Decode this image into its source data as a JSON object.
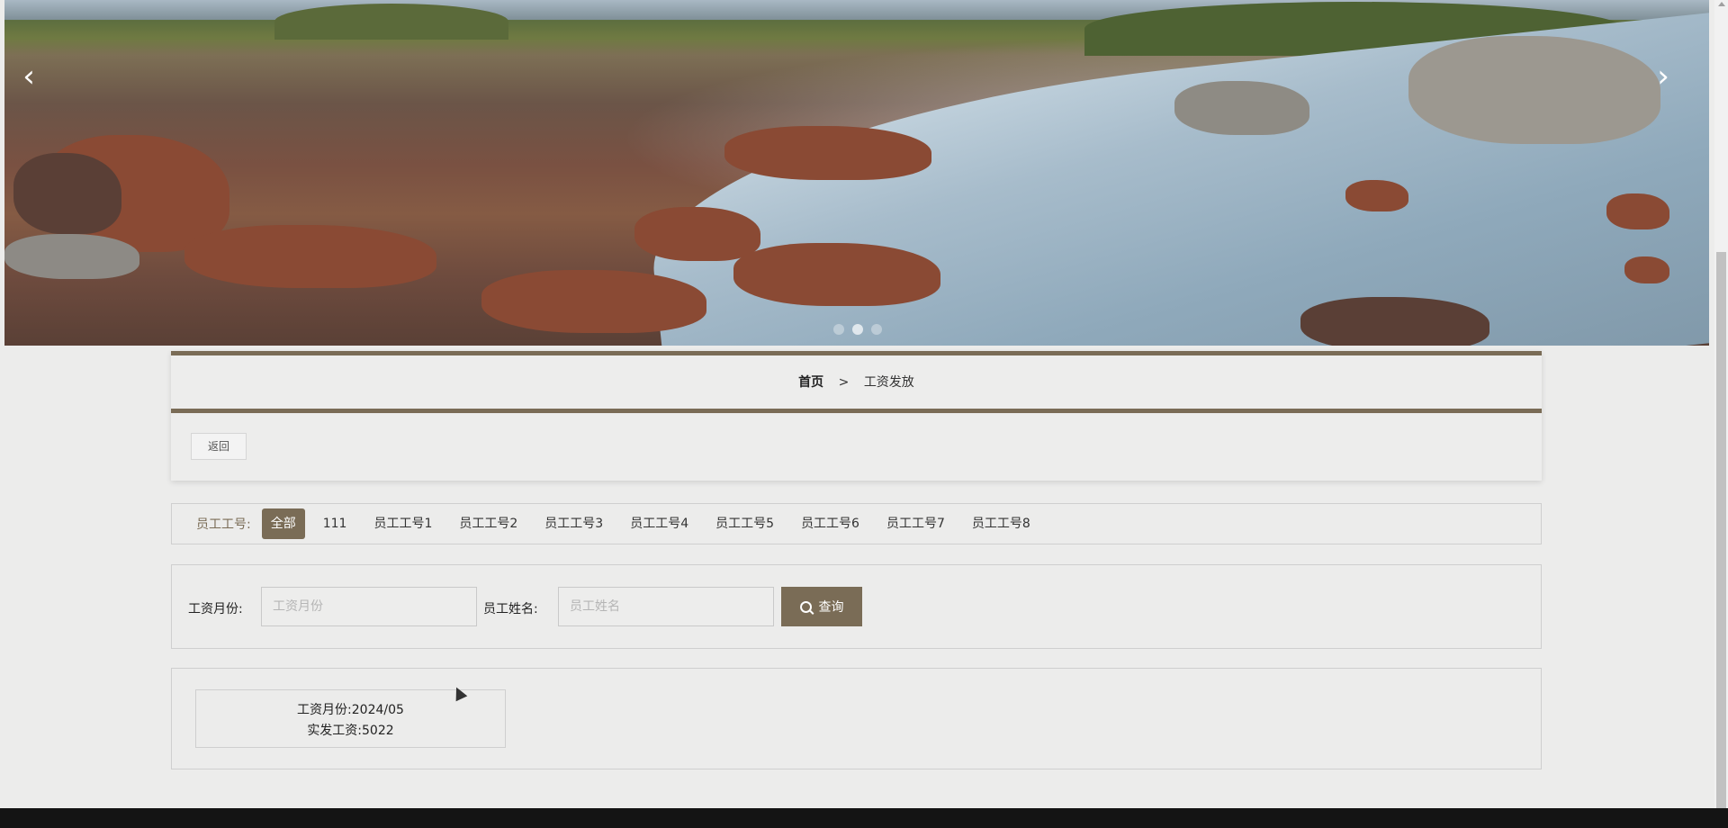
{
  "banner": {
    "prev_icon": "chevron-left-icon",
    "next_icon": "chevron-right-icon",
    "prev_glyph": "‹",
    "next_glyph": "›",
    "slide_count": 3,
    "active_slide": 2
  },
  "breadcrumb": {
    "home": "首页",
    "separator": ">",
    "current": "工资发放"
  },
  "actions": {
    "back_label": "返回"
  },
  "filter": {
    "label": "员工工号:",
    "options": [
      "全部",
      "111",
      "员工工号1",
      "员工工号2",
      "员工工号3",
      "员工工号4",
      "员工工号5",
      "员工工号6",
      "员工工号7",
      "员工工号8"
    ],
    "selected": "全部"
  },
  "search": {
    "month_label": "工资月份:",
    "month_placeholder": "工资月份",
    "name_label": "员工姓名:",
    "name_placeholder": "员工姓名",
    "query_label": "查询",
    "query_icon": "search-icon"
  },
  "results": [
    {
      "month_line": "工资月份:2024/05",
      "pay_line": "实发工资:5022"
    }
  ],
  "colors": {
    "accent": "#7a6c56",
    "background": "#ececeb",
    "footer": "#141414"
  }
}
